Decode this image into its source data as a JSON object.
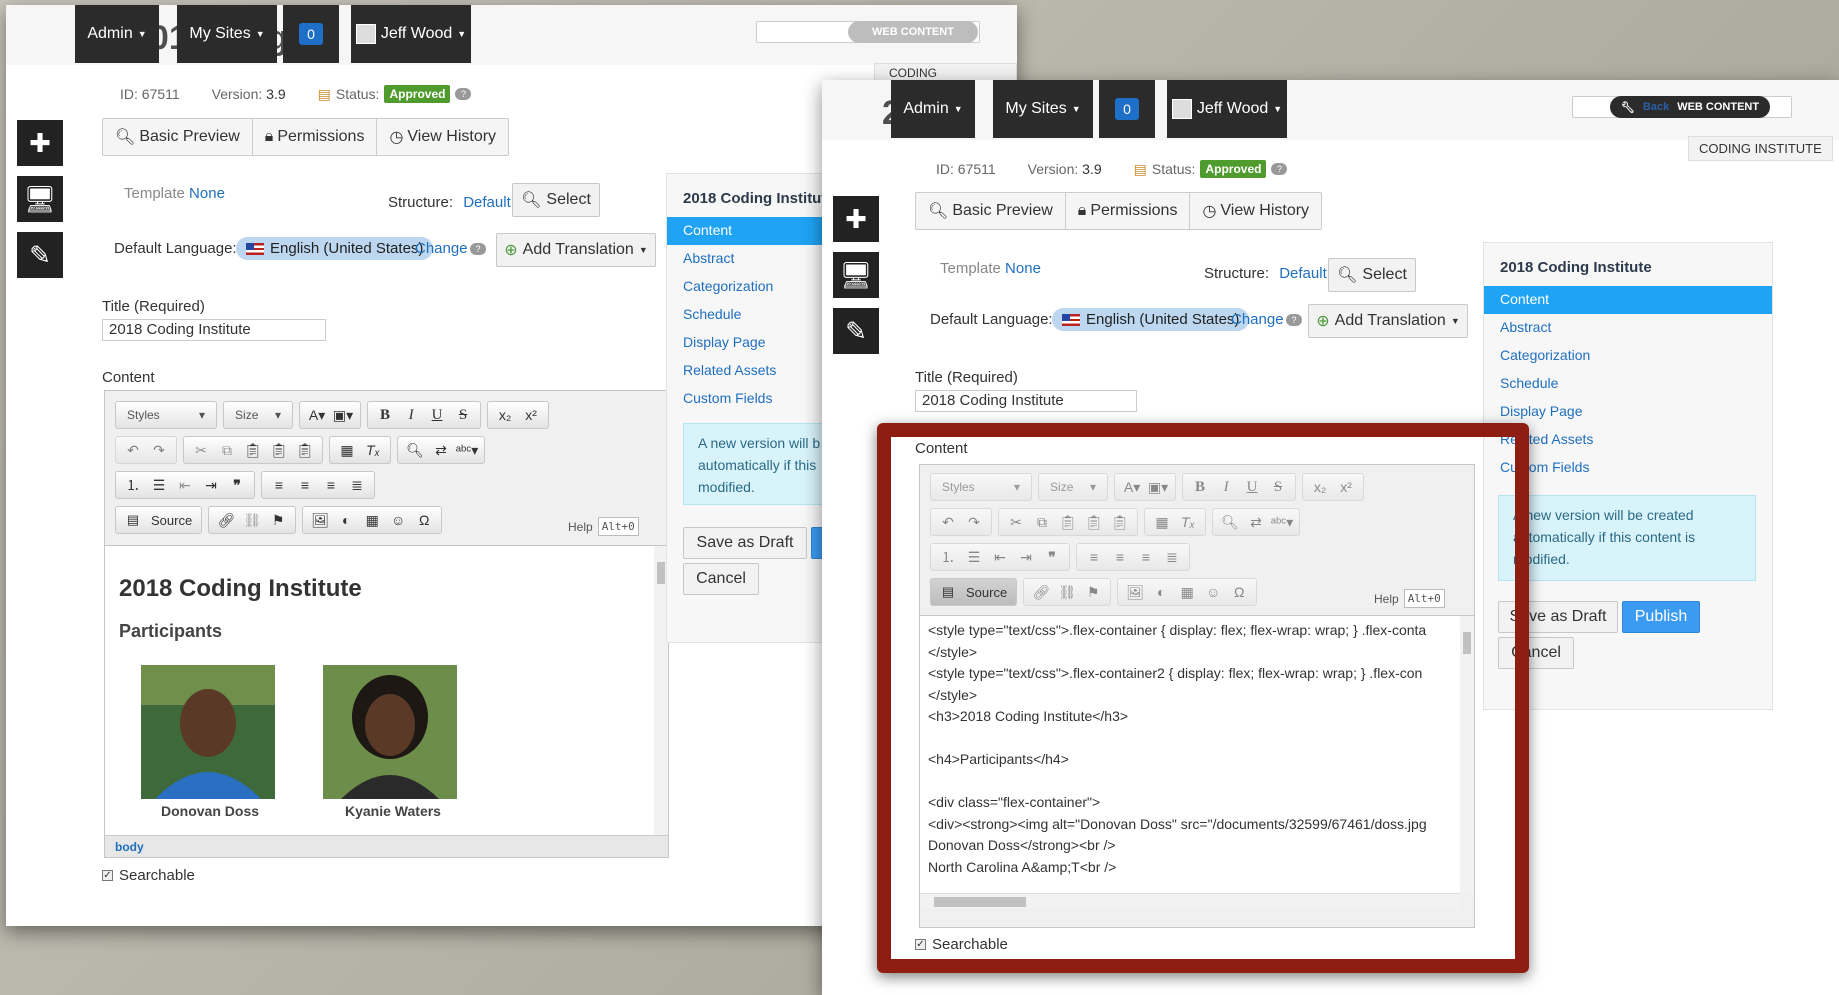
{
  "topnav": {
    "admin": "Admin",
    "my_sites": "My Sites",
    "badge": "0",
    "user": "Jeff Wood",
    "web_content": "WEB CONTENT",
    "back": "Back",
    "site_tag": "CODING INSTITUTE"
  },
  "meta": {
    "id": "ID: 67511",
    "version_label": "Version:",
    "version": "3.9",
    "status_label": "Status:",
    "status": "Approved"
  },
  "actions": {
    "basic_preview": "Basic Preview",
    "permissions": "Permissions",
    "view_history": "View History"
  },
  "form": {
    "template_label": "Template",
    "template_value": "None",
    "structure_label": "Structure:",
    "structure_value": "Default",
    "select": "Select",
    "default_language_label": "Default Language:",
    "language": "English (United States)",
    "change": "Change",
    "add_translation": "Add Translation",
    "title_label": "Title (Required)",
    "title_value": "2018 Coding Institute",
    "content_label": "Content",
    "searchable": "Searchable"
  },
  "editor": {
    "styles": "Styles",
    "size": "Size",
    "source": "Source",
    "help": "Help",
    "shortcut": "Alt+0",
    "path": "body",
    "heading": "2018 Coding Institute",
    "subheading": "Participants",
    "participants": [
      "Donovan Doss",
      "Kyanie Waters"
    ],
    "code_lines": [
      "<style type=\"text/css\">.flex-container { display: flex; flex-wrap: wrap; } .flex-conta",
      "</style>",
      "<style type=\"text/css\">.flex-container2 { display: flex; flex-wrap: wrap; } .flex-con",
      "</style>",
      "<h3>2018 Coding Institute</h3>",
      "",
      "<h4>Participants</h4>",
      "",
      "<div class=\"flex-container\">",
      "<div><strong><img alt=\"Donovan Doss\" src=\"/documents/32599/67461/doss.jpg",
      "Donovan Doss</strong><br />",
      "North Carolina A&amp;T<br />"
    ]
  },
  "sidebar": {
    "title": "2018 Coding Institute",
    "items": [
      "Content",
      "Abstract",
      "Categorization",
      "Schedule",
      "Display Page",
      "Related Assets",
      "Custom Fields"
    ],
    "alert": "A new version will be created automatically if this content is modified.",
    "alert_left": "A new version will b automatically if this modified.",
    "save_draft": "Save as Draft",
    "publish": "Publish",
    "cancel": "Cancel"
  },
  "colors": {
    "accent": "#1fa3f5",
    "status_green": "#4f9b2d",
    "frame_red": "#8e1d12",
    "navbar": "#2b2b2b"
  }
}
